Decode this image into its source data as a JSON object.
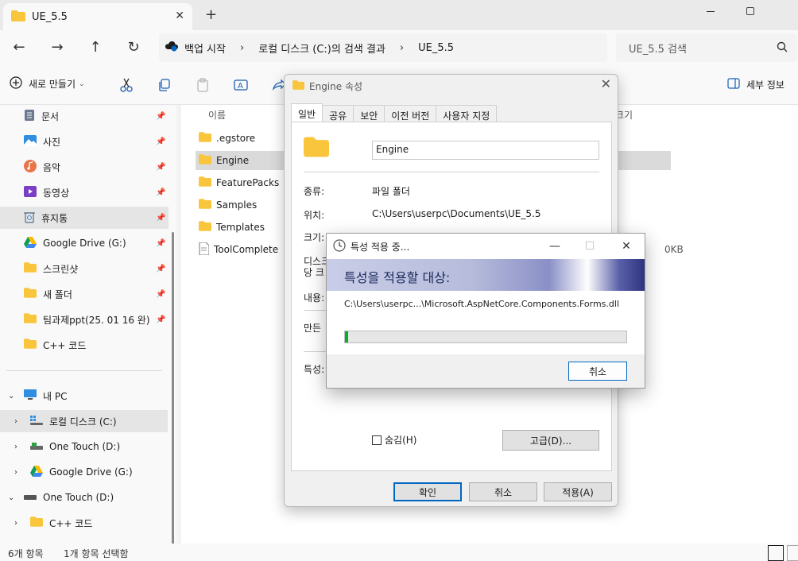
{
  "tab": {
    "title": "UE_5.5"
  },
  "address": {
    "root": "백업 시작",
    "crumbs": [
      "로컬 디스크 (C:)의 검색 결과",
      "UE_5.5"
    ]
  },
  "search": {
    "placeholder": "UE_5.5 검색"
  },
  "toolbar": {
    "new_label": "새로 만들기",
    "details_label": "세부 정보"
  },
  "sidebar": {
    "quick": [
      {
        "label": "문서",
        "icon": "documents-icon"
      },
      {
        "label": "사진",
        "icon": "pictures-icon"
      },
      {
        "label": "음악",
        "icon": "music-icon"
      },
      {
        "label": "동영상",
        "icon": "videos-icon"
      },
      {
        "label": "휴지통",
        "icon": "recycle-bin-icon"
      },
      {
        "label": "Google Drive (G:)",
        "icon": "google-drive-icon"
      },
      {
        "label": "스크린샷",
        "icon": "folder-icon"
      },
      {
        "label": "새 폴더",
        "icon": "folder-icon"
      },
      {
        "label": "팀과제ppt(25. 01 16 완)",
        "icon": "folder-icon"
      },
      {
        "label": "C++ 코드",
        "icon": "folder-icon"
      }
    ],
    "tree": [
      {
        "label": "내 PC"
      },
      {
        "label": "로컬 디스크 (C:)"
      },
      {
        "label": "One Touch (D:)"
      },
      {
        "label": "Google Drive (G:)"
      },
      {
        "label": "One Touch (D:)"
      },
      {
        "label": "C++ 코드"
      }
    ]
  },
  "filelist": {
    "col_name": "이름",
    "col_size": "크기",
    "files": [
      ".egstore",
      "Engine",
      "FeaturePacks",
      "Samples",
      "Templates",
      "ToolComplete"
    ],
    "toolcomplete_size": "0KB"
  },
  "status": {
    "count": "6개 항목",
    "selected": "1개 항목 선택함"
  },
  "props": {
    "title": "Engine 속성",
    "tabs": [
      "일반",
      "공유",
      "보안",
      "이전 버전",
      "사용자 지정"
    ],
    "name": "Engine",
    "type_label": "종류:",
    "type_value": "파일 폴더",
    "location_label": "위치:",
    "location_value": "C:\\Users\\userpc\\Documents\\UE_5.5",
    "size_label": "크기:",
    "disk_label_1": "디스크",
    "disk_label_2": "당 크",
    "contents_label": "내용:",
    "created_label": "만든",
    "attr_label": "특성:",
    "hidden_label": "숨김(H)",
    "advanced_label": "고급(D)...",
    "ok": "확인",
    "cancel": "취소",
    "apply": "적용(A)"
  },
  "progress": {
    "title": "특성 적용 중...",
    "banner": "특성을 적용할 대상:",
    "path": "C:\\Users\\userpc...\\Microsoft.AspNetCore.Components.Forms.dll",
    "percent": 1,
    "cancel": "취소"
  },
  "colors": {
    "accent": "#0067c0",
    "progress": "#06b025",
    "folder": "#f8c53d"
  }
}
